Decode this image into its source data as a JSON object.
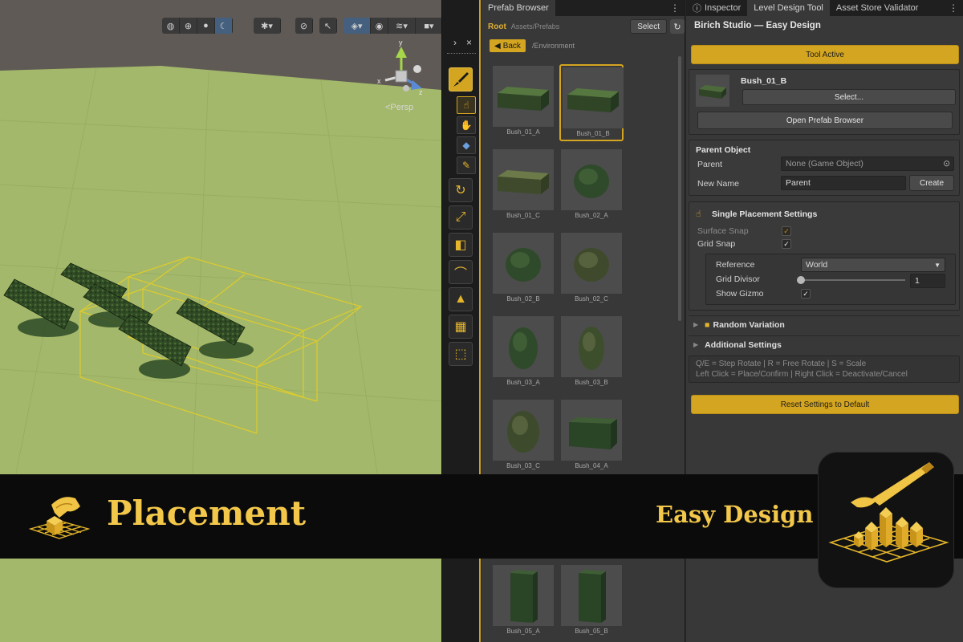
{
  "scene": {
    "view_label": "<Persp",
    "gizmo_axes": [
      "x",
      "y",
      "z"
    ],
    "toolbar_icons": [
      "globe-icon",
      "globe-grid-icon",
      "circle-icon",
      "moon-icon",
      "bug-icon",
      "audio-off-icon",
      "cursor-icon",
      "layers-icon",
      "eye-icon",
      "stack-icon",
      "camera-icon",
      "gizmo-icon"
    ]
  },
  "toolstrip": {
    "collapse_label": "> ×",
    "tools": [
      "brush-icon",
      "hand-place-icon",
      "rotate-icon",
      "scale-icon",
      "eraser-icon",
      "curve-icon",
      "shapes-icon",
      "grid-icon",
      "selection-icon"
    ]
  },
  "prefab_browser": {
    "tab": "Prefab Browser",
    "root": "Root",
    "path": "Assets/Prefabs",
    "select_label": "Select",
    "back_label": "Back",
    "env_path": "/Environment",
    "items": [
      {
        "label": "Bush_01_A",
        "kind": "long",
        "selected": false
      },
      {
        "label": "Bush_01_B",
        "kind": "long",
        "selected": true
      },
      {
        "label": "Bush_01_C",
        "kind": "long-light",
        "selected": false
      },
      {
        "label": "Bush_02_A",
        "kind": "round",
        "selected": false
      },
      {
        "label": "Bush_02_B",
        "kind": "round",
        "selected": false
      },
      {
        "label": "Bush_02_C",
        "kind": "round-light",
        "selected": false
      },
      {
        "label": "Bush_03_A",
        "kind": "tall",
        "selected": false
      },
      {
        "label": "Bush_03_B",
        "kind": "tall-light",
        "selected": false
      },
      {
        "label": "Bush_03_C",
        "kind": "oval",
        "selected": false
      },
      {
        "label": "Bush_04_A",
        "kind": "box",
        "selected": false
      },
      {
        "label": "Bush_05_A",
        "kind": "pillar",
        "selected": false
      },
      {
        "label": "Bush_05_B",
        "kind": "pillar",
        "selected": false
      }
    ]
  },
  "inspector": {
    "tabs": [
      "Inspector",
      "Level Design Tool",
      "Asset Store Validator"
    ],
    "title": "Birich Studio — Easy Design",
    "tool_active": "Tool Active",
    "prefab_name": "Bush_01_B",
    "select_btn": "Select...",
    "open_browser": "Open Prefab Browser",
    "parent_section": "Parent Object",
    "parent_label": "Parent",
    "parent_value": "None (Game Object)",
    "new_name_label": "New Name",
    "new_name_value": "Parent",
    "create_btn": "Create",
    "single_placement": "Single Placement Settings",
    "surface_snap": "Surface Snap",
    "grid_snap": "Grid Snap",
    "reference_label": "Reference",
    "reference_value": "World",
    "grid_divisor_label": "Grid Divisor",
    "grid_divisor_value": "1",
    "grid_divisor_fraction": 0,
    "show_gizmo": "Show Gizmo",
    "random_variation": "Random Variation",
    "additional_settings": "Additional Settings",
    "help_line1": "Q/E = Step Rotate | R = Free Rotate | S = Scale",
    "help_line2": "Left Click = Place/Confirm | Right Click = Deactivate/Cancel",
    "reset_btn": "Reset Settings to Default"
  },
  "banner": {
    "title": "Placement",
    "brand": "Easy Design"
  },
  "colors": {
    "accent": "#d4a520",
    "banner_text": "#f3c84a",
    "ground": "#a3b86a",
    "sky": "#5f5a55"
  }
}
